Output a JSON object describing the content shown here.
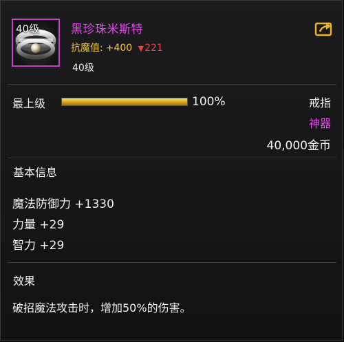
{
  "item": {
    "level_badge": "40级",
    "name": "黑珍珠米斯特",
    "resist_label": "抗魔值",
    "resist_sep": ":",
    "resist_value": "+400",
    "resist_delta": "221",
    "level_text": "40级",
    "icon": "pearl-ring-icon"
  },
  "grade": {
    "label": "最上级",
    "percent_text": "100%",
    "fill_fraction": 1.0
  },
  "meta": {
    "type": "戒指",
    "rarity": "神器",
    "price": "40,000金币"
  },
  "basic_info": {
    "title": "基本信息",
    "stats": [
      "魔法防御力 +1330",
      "力量 +29",
      "智力 +29"
    ]
  },
  "effect": {
    "title": "效果",
    "text": "破招魔法攻击时，增加50%的伤害。"
  },
  "colors": {
    "rarity": "#e24ae8",
    "resist": "#f2c838",
    "decrease": "#f04040",
    "bar_gold": "#d9b021"
  }
}
